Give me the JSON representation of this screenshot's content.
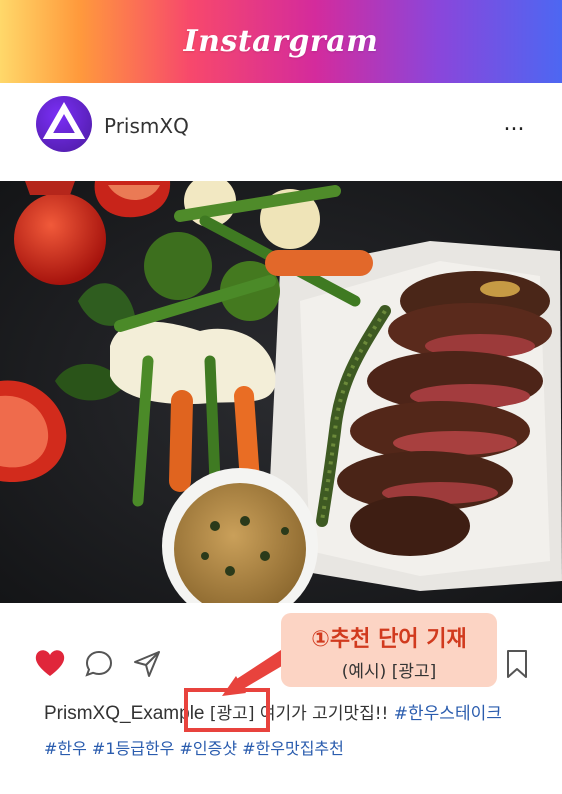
{
  "header": {
    "title": "Instargram"
  },
  "profile": {
    "username": "PrismXQ",
    "more_label": "..."
  },
  "post": {
    "image_alt": "steak with vegetables",
    "caption": {
      "username": "PrismXQ_Example",
      "ad_tag": "[광고]",
      "text": "여기가 고기맛집!!",
      "inline_hashtag": "#한우스테이크",
      "hashtags": "#한우 #1등급한우 #인증샷 #한우맛집추천"
    }
  },
  "annotation": {
    "title": "①추천 단어 기재",
    "example": "(예시) [광고]"
  },
  "colors": {
    "like": "#e0263b",
    "accent": "#e8433d",
    "hashtag": "#2a5cae"
  }
}
